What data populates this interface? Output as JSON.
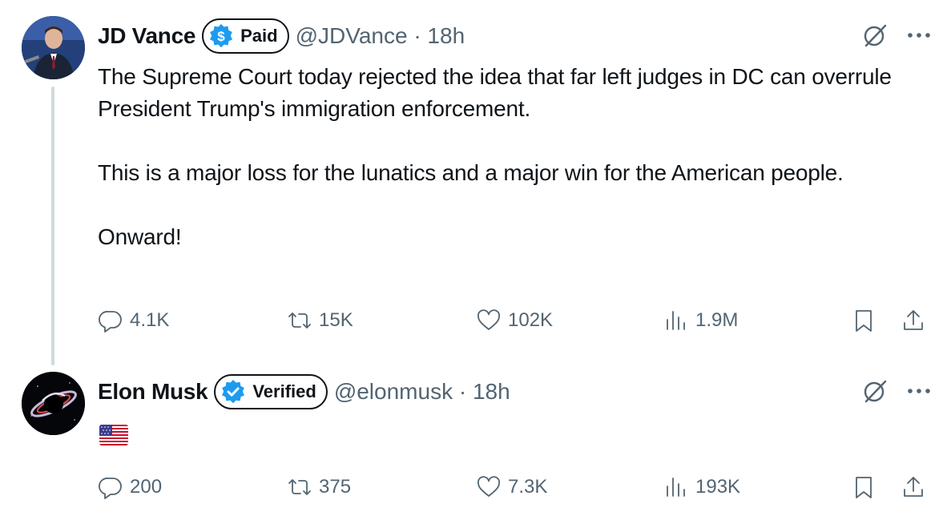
{
  "tweets": [
    {
      "name": "JD Vance",
      "badge": "Paid",
      "handle": "@JDVance · 18h",
      "text": "The Supreme Court today rejected the idea that far left judges in DC can overrule President Trump's immigration enforcement.\n\nThis is a major loss for the lunatics and a major win for the American people.\n\nOnward!",
      "stats": {
        "replies": "4.1K",
        "reposts": "15K",
        "likes": "102K",
        "views": "1.9M"
      }
    },
    {
      "name": "Elon Musk",
      "badge": "Verified",
      "handle": "@elonmusk · 18h",
      "text_icon": "us-flag-emoji",
      "stats": {
        "replies": "200",
        "reposts": "375",
        "likes": "7.3K",
        "views": "193K"
      }
    }
  ],
  "icons": {
    "paid_badge": "dollar-circle-icon",
    "verified_badge": "blue-check-icon",
    "grok": "grok-icon",
    "more": "more-dots-icon",
    "reply": "reply-icon",
    "repost": "repost-icon",
    "like": "heart-icon",
    "views": "views-icon",
    "bookmark": "bookmark-icon",
    "share": "share-icon"
  },
  "colors": {
    "text": "#0f1419",
    "muted": "#536471",
    "paid_green": "#1d9bf0",
    "verified_blue": "#1d9bf0",
    "thread_line": "#cfd9de"
  }
}
